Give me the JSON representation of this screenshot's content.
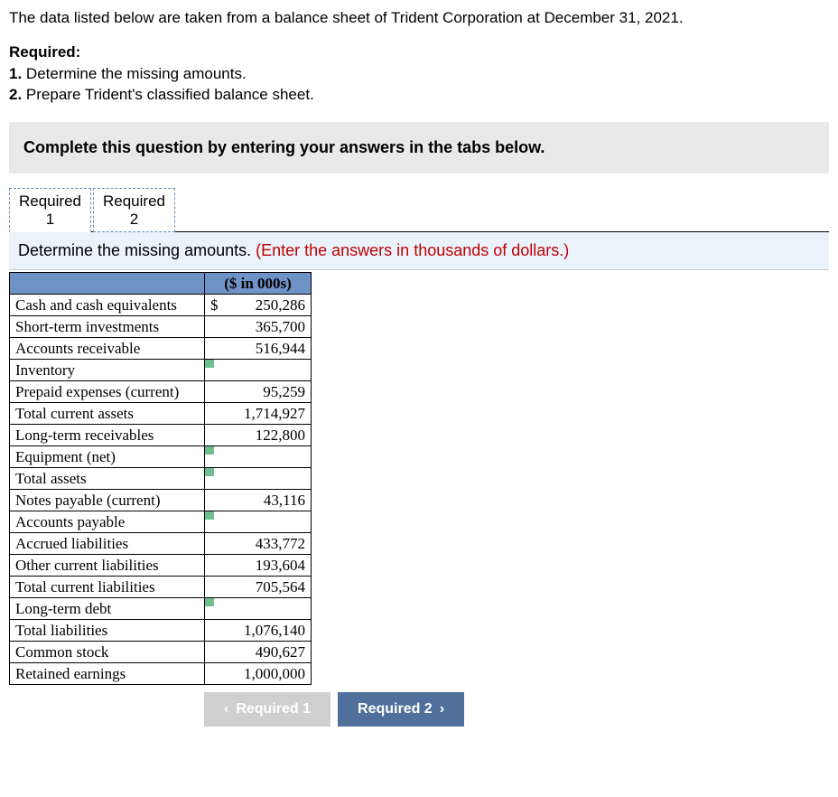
{
  "intro": "The data listed below are taken from a balance sheet of Trident Corporation at December 31, 2021.",
  "required": {
    "heading": "Required:",
    "items": [
      {
        "num": "1.",
        "text": "Determine the missing amounts."
      },
      {
        "num": "2.",
        "text": "Prepare Trident's classified balance sheet."
      }
    ]
  },
  "banner": "Complete this question by entering your answers in the tabs below.",
  "tabs": [
    {
      "label": "Required\n1",
      "active": true
    },
    {
      "label": "Required\n2",
      "active": false
    }
  ],
  "instruction": {
    "main": "Determine the missing amounts. ",
    "hint": "(Enter the answers in thousands of dollars.)"
  },
  "table": {
    "header": "($ in 000s)",
    "rows": [
      {
        "label": "Cash and cash equivalents",
        "value": "250,286",
        "dollar": true,
        "input": false
      },
      {
        "label": "Short-term investments",
        "value": "365,700",
        "input": false
      },
      {
        "label": "Accounts receivable",
        "value": "516,944",
        "input": false
      },
      {
        "label": "Inventory",
        "value": "",
        "input": true
      },
      {
        "label": "Prepaid expenses (current)",
        "value": "95,259",
        "input": false
      },
      {
        "label": "Total current assets",
        "value": "1,714,927",
        "input": false
      },
      {
        "label": "Long-term receivables",
        "value": "122,800",
        "input": false
      },
      {
        "label": "Equipment (net)",
        "value": "",
        "input": true
      },
      {
        "label": "Total assets",
        "value": "",
        "input": true
      },
      {
        "label": "Notes payable (current)",
        "value": "43,116",
        "input": false
      },
      {
        "label": "Accounts payable",
        "value": "",
        "input": true
      },
      {
        "label": "Accrued liabilities",
        "value": "433,772",
        "input": false
      },
      {
        "label": "Other current liabilities",
        "value": "193,604",
        "input": false
      },
      {
        "label": "Total current liabilities",
        "value": "705,564",
        "input": false
      },
      {
        "label": "Long-term debt",
        "value": "",
        "input": true
      },
      {
        "label": "Total liabilities",
        "value": "1,076,140",
        "input": false
      },
      {
        "label": "Common stock",
        "value": "490,627",
        "input": false
      },
      {
        "label": "Retained earnings",
        "value": "1,000,000",
        "input": false
      }
    ]
  },
  "nav": {
    "prev": "Required 1",
    "next": "Required 2"
  }
}
